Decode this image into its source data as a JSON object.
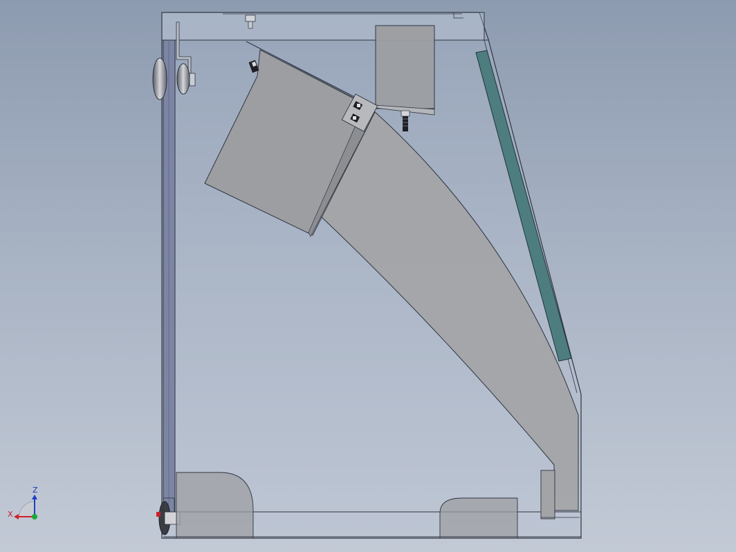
{
  "triad": {
    "x_label": "X",
    "z_label": "Z"
  },
  "colors": {
    "background_top": "#8d9bb0",
    "background_bottom": "#c3cad6",
    "housing_glass": "#b4c0d2",
    "housing_edge": "#2e3440",
    "sheet_metal": "#9c9ea1",
    "chute": "#a3a4a6",
    "window_panel": "#4e7d80",
    "door_frame": "#7c85a3",
    "x_axis": "#d0202a",
    "y_axis": "#1aa83c",
    "z_axis": "#1c3fc8"
  },
  "icons": [
    "hinge-roller-icon",
    "bolt-icon",
    "nut-icon",
    "triad-icon"
  ]
}
